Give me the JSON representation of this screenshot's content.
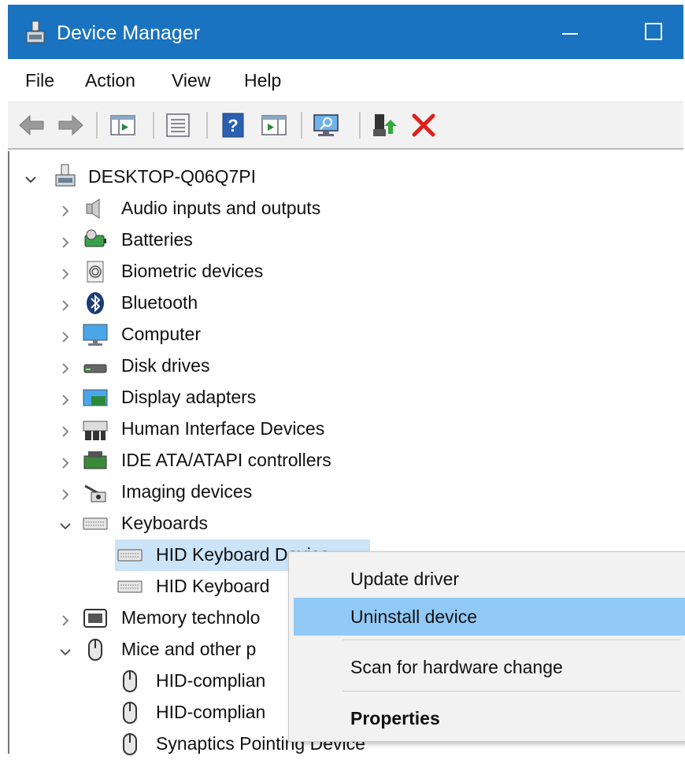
{
  "window": {
    "title": "Device Manager"
  },
  "menu": [
    "File",
    "Action",
    "View",
    "Help"
  ],
  "toolbar": [
    "back-icon",
    "forward-icon",
    "show-hide-console-tree-icon",
    "properties-sheet-icon",
    "help-icon",
    "show-action-pane-icon",
    "scan-hardware-icon",
    "update-driver-icon",
    "uninstall-icon"
  ],
  "colors": {
    "titlebar": "#1a73c0",
    "selection": "#cce4f7",
    "menu_highlight": "#91c9f7",
    "uninstall_red": "#e0201b"
  },
  "tree": {
    "root": "DESKTOP-Q06Q7PI",
    "categories": [
      {
        "label": "Audio inputs and outputs",
        "icon": "speaker-icon",
        "expanded": false
      },
      {
        "label": "Batteries",
        "icon": "battery-icon",
        "expanded": false
      },
      {
        "label": "Biometric devices",
        "icon": "fingerprint-icon",
        "expanded": false
      },
      {
        "label": "Bluetooth",
        "icon": "bluetooth-icon",
        "expanded": false
      },
      {
        "label": "Computer",
        "icon": "monitor-icon",
        "expanded": false
      },
      {
        "label": "Disk drives",
        "icon": "disk-drive-icon",
        "expanded": false
      },
      {
        "label": "Display adapters",
        "icon": "display-adapter-icon",
        "expanded": false
      },
      {
        "label": "Human Interface Devices",
        "icon": "hid-icon",
        "expanded": false
      },
      {
        "label": "IDE ATA/ATAPI controllers",
        "icon": "ide-controller-icon",
        "expanded": false
      },
      {
        "label": "Imaging devices",
        "icon": "camera-icon",
        "expanded": false
      },
      {
        "label": "Keyboards",
        "icon": "keyboard-icon",
        "expanded": true
      },
      {
        "label": "HID Keyboard Device",
        "icon": "keyboard-icon",
        "child": true
      },
      {
        "label": "HID Keyboard",
        "icon": "keyboard-icon",
        "child": true
      },
      {
        "label": "Memory technolo",
        "icon": "memory-icon",
        "expanded": false
      },
      {
        "label": "Mice and other p",
        "icon": "mouse-icon",
        "expanded": true
      },
      {
        "label": "HID-complian",
        "icon": "mouse-icon",
        "child": true
      },
      {
        "label": "HID-complian",
        "icon": "mouse-icon",
        "child": true
      },
      {
        "label": "Synaptics Pointing Device",
        "icon": "mouse-icon",
        "child": true
      }
    ]
  },
  "context_menu": {
    "update_driver": "Update driver",
    "uninstall_device": "Uninstall device",
    "scan": "Scan for hardware change",
    "properties": "Properties"
  }
}
